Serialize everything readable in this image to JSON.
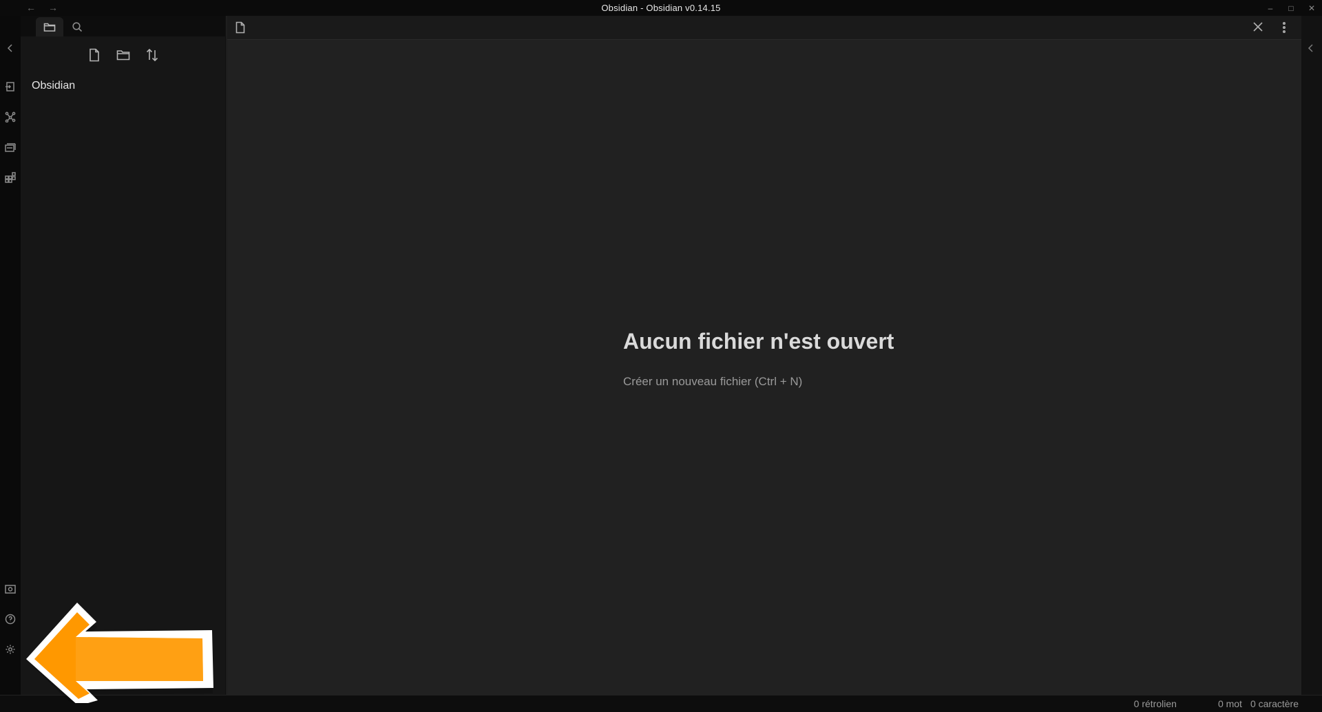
{
  "window": {
    "title": "Obsidian - Obsidian v0.14.15",
    "nav_back_icon": "arrow-left-icon",
    "nav_forward_icon": "arrow-right-icon",
    "controls": [
      "minimize-icon",
      "maximize-icon",
      "close-icon"
    ]
  },
  "ribbon": {
    "top_icons": [
      "collapse-left-icon",
      "switcher-icon",
      "graph-icon",
      "templates-icon",
      "plugins-icon"
    ],
    "bottom_icons": [
      "vault-icon",
      "help-icon",
      "settings-icon"
    ]
  },
  "sidebar": {
    "tabs": [
      {
        "icon": "folder-icon",
        "active": true
      },
      {
        "icon": "search-icon",
        "active": false
      }
    ],
    "actions": [
      "new-note-icon",
      "new-folder-icon",
      "sort-icon"
    ],
    "vault_name": "Obsidian"
  },
  "editor": {
    "tab_icon": "document-icon",
    "empty_title": "Aucun fichier n'est ouvert",
    "empty_action": "Créer un nouveau fichier (Ctrl + N)"
  },
  "status": {
    "backlinks": "0 rétrolien",
    "words": "0 mot",
    "characters": "0 caractère"
  },
  "annotation": {
    "icon": "pointer-arrow-icon",
    "fill_color": "#ff9800",
    "border_color": "#ffffff"
  }
}
